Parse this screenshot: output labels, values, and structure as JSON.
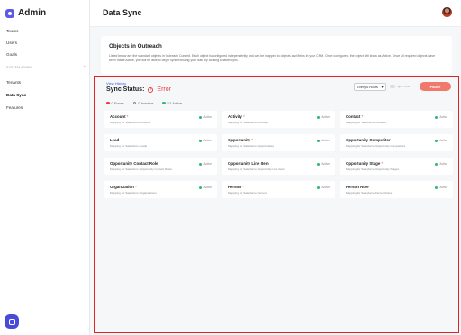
{
  "app": {
    "name": "Admin"
  },
  "sidebar": {
    "items": [
      {
        "label": "Teams"
      },
      {
        "label": "Users"
      },
      {
        "label": "Goals"
      }
    ],
    "section_label": "SYSTEM ADMIN",
    "admin_items": [
      {
        "label": "Tenants"
      },
      {
        "label": "Data Sync"
      },
      {
        "label": "Features"
      }
    ],
    "active": "Data Sync"
  },
  "header": {
    "title": "Data Sync"
  },
  "intro": {
    "title": "Objects in Outreach",
    "description": "Listed below are the standard objects in Outreach Commit. Each object is configured independently and can be mapped to objects and fields in your CRM. Once configured, the object will show as Active. Once all required objects have been made Active, you will be able to begin synchronizing your data by clicking Enable Sync."
  },
  "sync": {
    "view_history": "View History",
    "status_label": "Sync Status:",
    "status_value": "Error",
    "counts": [
      {
        "label": "0 Errors",
        "color": "#e53e3e"
      },
      {
        "label": "0 Inactive",
        "color": "#888888"
      },
      {
        "label": "12 Active",
        "color": "#2fb872"
      }
    ],
    "schedule": "Every 6 hours",
    "toggle_label": "sync now",
    "pause_label": "Pause"
  },
  "objects": [
    {
      "name": "Account",
      "required": true,
      "desc": "Mapping for Salesforce Accounts",
      "status": "Active"
    },
    {
      "name": "Activity",
      "required": true,
      "desc": "Mapping for Salesforce Activities",
      "status": "Active"
    },
    {
      "name": "Contact",
      "required": true,
      "desc": "Mapping for Salesforce Contacts",
      "status": "Active"
    },
    {
      "name": "Lead",
      "required": false,
      "desc": "Mapping for Salesforce Leads",
      "status": "Active"
    },
    {
      "name": "Opportunity",
      "required": true,
      "desc": "Mapping for Salesforce Opportunities",
      "status": "Active"
    },
    {
      "name": "Opportunity Competitor",
      "required": false,
      "desc": "Mapping for Salesforce Opportunity Competitors",
      "status": "Active"
    },
    {
      "name": "Opportunity Contact Role",
      "required": false,
      "desc": "Mapping for Salesforce Opportunity Contact Roles",
      "status": "Active"
    },
    {
      "name": "Opportunity Line Item",
      "required": false,
      "desc": "Mapping for Salesforce Opportunity Line Items",
      "status": "Active"
    },
    {
      "name": "Opportunity Stage",
      "required": true,
      "desc": "Mapping for Salesforce Opportunity Stages",
      "status": "Active"
    },
    {
      "name": "Organization",
      "required": true,
      "desc": "Mapping for Salesforce Organizations",
      "status": "Active"
    },
    {
      "name": "Person",
      "required": true,
      "desc": "Mapping for Salesforce Persons",
      "status": "Active"
    },
    {
      "name": "Person Role",
      "required": false,
      "desc": "Mapping for Salesforce Person Roles",
      "status": "Active"
    }
  ],
  "colors": {
    "accent": "#5b5be6",
    "error": "#e53e3e",
    "active": "#2fb872",
    "pause": "#f0796b",
    "highlight": "#e02424"
  },
  "icons": {
    "logo": "shield-logo-icon",
    "help": "chat-help-icon",
    "error": "error-circle-icon"
  }
}
